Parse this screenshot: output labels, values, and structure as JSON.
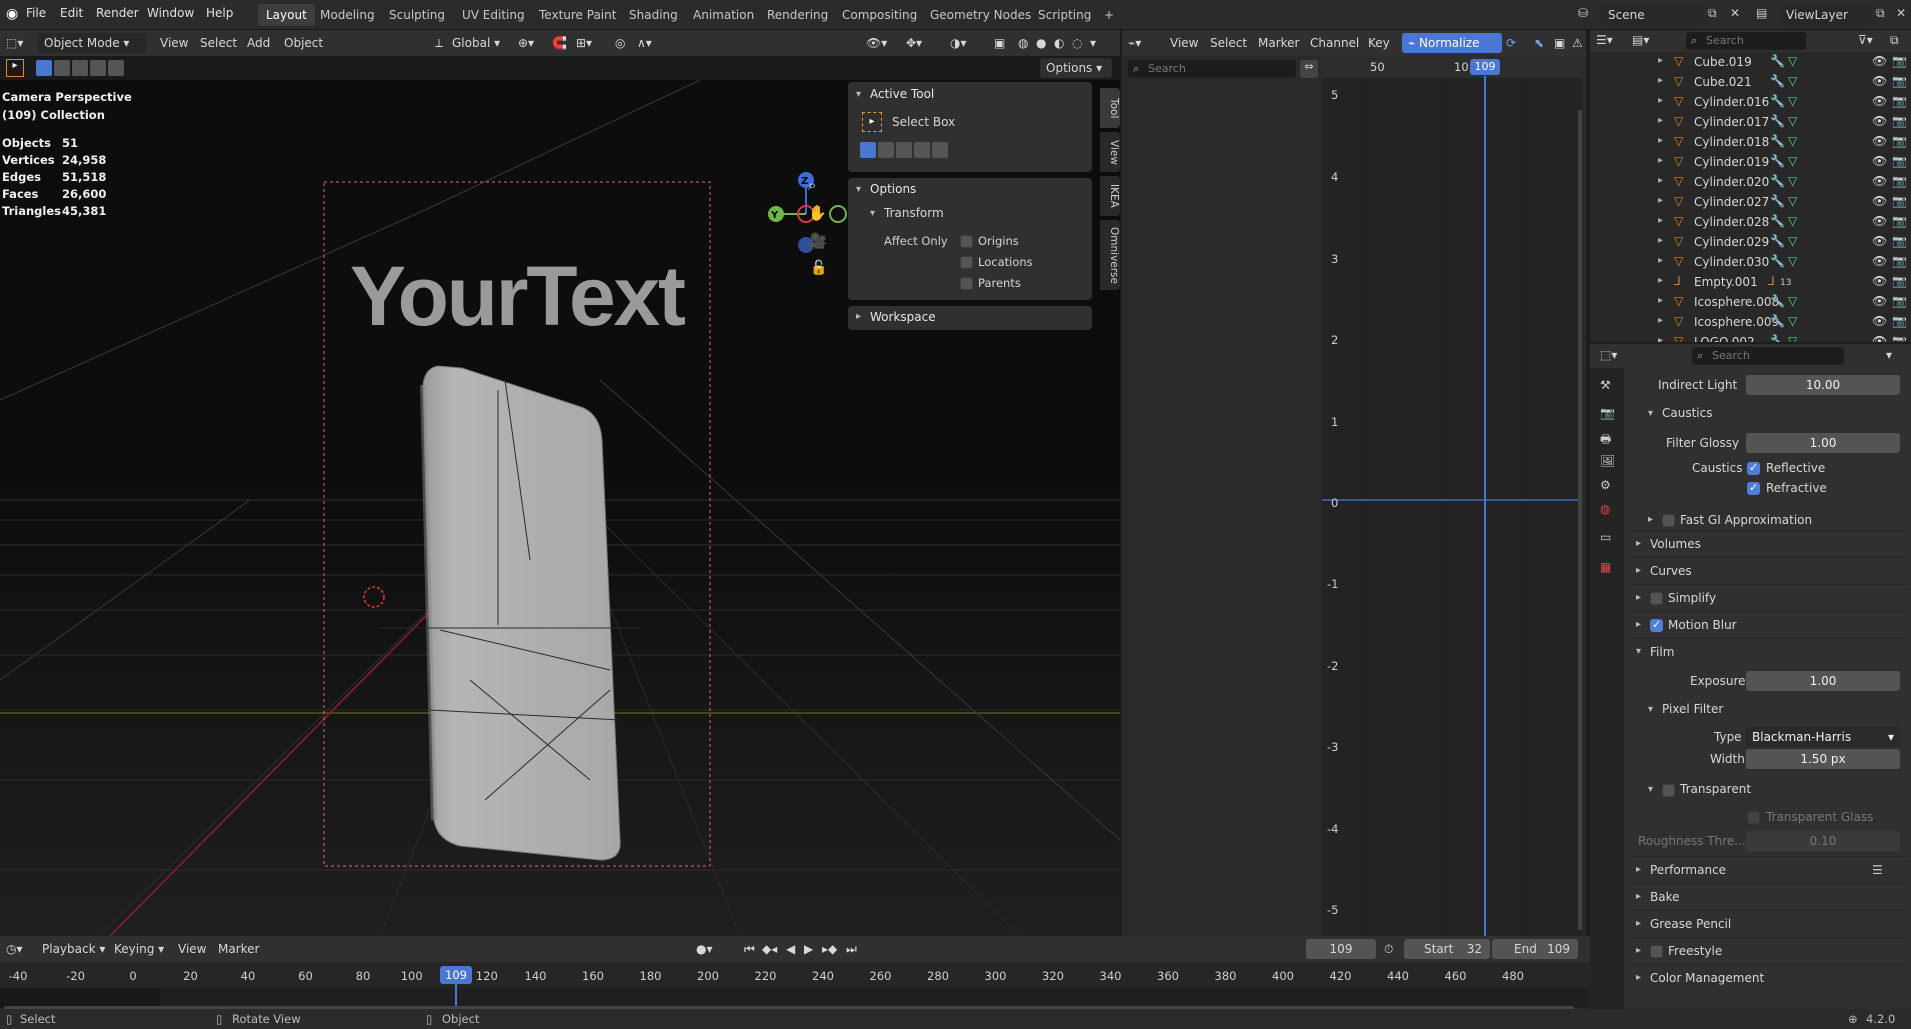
{
  "topbar": {
    "menus": [
      "File",
      "Edit",
      "Render",
      "Window",
      "Help"
    ],
    "workspaces": [
      "Layout",
      "Modeling",
      "Sculpting",
      "UV Editing",
      "Texture Paint",
      "Shading",
      "Animation",
      "Rendering",
      "Compositing",
      "Geometry Nodes",
      "Scripting"
    ],
    "active_workspace": "Layout",
    "add_tab": "+",
    "scene_label": "Scene",
    "viewlayer_label": "ViewLayer"
  },
  "viewport_header": {
    "mode": "Object Mode",
    "menus": [
      "View",
      "Select",
      "Add",
      "Object"
    ],
    "orientation": "Global",
    "options_label": "Options"
  },
  "viewport": {
    "camera_label": "Camera Perspective",
    "collection_label": "(109) Collection",
    "stats": [
      {
        "label": "Objects",
        "value": "51"
      },
      {
        "label": "Vertices",
        "value": "24,958"
      },
      {
        "label": "Edges",
        "value": "51,518"
      },
      {
        "label": "Faces",
        "value": "26,600"
      },
      {
        "label": "Triangles",
        "value": "45,381"
      }
    ],
    "text_object": "YourText",
    "gizmo": {
      "z": "Z",
      "y": "Y"
    }
  },
  "npanel": {
    "active_tool_title": "Active Tool",
    "tool_name": "Select Box",
    "options_title": "Options",
    "transform_title": "Transform",
    "affect_only_label": "Affect Only",
    "affect_options": [
      {
        "label": "Origins",
        "checked": false
      },
      {
        "label": "Locations",
        "checked": false
      },
      {
        "label": "Parents",
        "checked": false
      }
    ],
    "workspace_title": "Workspace",
    "side_tabs": [
      "Tool",
      "View",
      "IKEA",
      "Omniverse"
    ]
  },
  "graph_editor": {
    "menus": [
      "View",
      "Select",
      "Marker",
      "Channel",
      "Key"
    ],
    "normalize_label": "Normalize",
    "search_placeholder": "Search",
    "x_ticks": [
      "50",
      "10"
    ],
    "current_frame": "109",
    "y_ticks": [
      "5",
      "4",
      "3",
      "2",
      "1",
      "0",
      "-1",
      "-2",
      "-3",
      "-4",
      "-5"
    ]
  },
  "outliner": {
    "search_placeholder": "Search",
    "items": [
      {
        "name": "Cube.019",
        "type": "mesh"
      },
      {
        "name": "Cube.021",
        "type": "mesh"
      },
      {
        "name": "Cylinder.016",
        "type": "mesh"
      },
      {
        "name": "Cylinder.017",
        "type": "mesh"
      },
      {
        "name": "Cylinder.018",
        "type": "mesh"
      },
      {
        "name": "Cylinder.019",
        "type": "mesh"
      },
      {
        "name": "Cylinder.020",
        "type": "mesh"
      },
      {
        "name": "Cylinder.027",
        "type": "mesh"
      },
      {
        "name": "Cylinder.028",
        "type": "mesh"
      },
      {
        "name": "Cylinder.029",
        "type": "mesh"
      },
      {
        "name": "Cylinder.030",
        "type": "mesh"
      },
      {
        "name": "Empty.001",
        "type": "empty",
        "badge": "13"
      },
      {
        "name": "Icosphere.008",
        "type": "mesh"
      },
      {
        "name": "Icosphere.009",
        "type": "mesh"
      },
      {
        "name": "LOGO.002",
        "type": "mesh"
      }
    ]
  },
  "properties": {
    "search_placeholder": "Search",
    "indirect_light_label": "Indirect Light",
    "indirect_light_value": "10.00",
    "caustics_title": "Caustics",
    "filter_glossy_label": "Filter Glossy",
    "filter_glossy_value": "1.00",
    "caustics_label": "Caustics",
    "reflective_label": "Reflective",
    "refractive_label": "Refractive",
    "fast_gi_label": "Fast GI Approximation",
    "volumes_label": "Volumes",
    "curves_label": "Curves",
    "simplify_label": "Simplify",
    "motion_blur_label": "Motion Blur",
    "film_label": "Film",
    "exposure_label": "Exposure",
    "exposure_value": "1.00",
    "pixel_filter_label": "Pixel Filter",
    "type_label": "Type",
    "type_value": "Blackman-Harris",
    "width_label": "Width",
    "width_value": "1.50 px",
    "transparent_label": "Transparent",
    "transparent_glass_label": "Transparent Glass",
    "roughness_label": "Roughness Thre...",
    "roughness_value": "0.10",
    "performance_label": "Performance",
    "bake_label": "Bake",
    "grease_pencil_label": "Grease Pencil",
    "freestyle_label": "Freestyle",
    "color_management_label": "Color Management"
  },
  "timeline": {
    "menus": [
      "Playback",
      "Keying",
      "View",
      "Marker"
    ],
    "current_frame": "109",
    "start_label": "Start",
    "start_value": "32",
    "end_label": "End",
    "end_value": "109",
    "ticks": [
      "-40",
      "-20",
      "0",
      "20",
      "40",
      "60",
      "80",
      "100",
      "120",
      "140",
      "160",
      "180",
      "200",
      "220",
      "240",
      "260",
      "280",
      "300",
      "320",
      "340",
      "360",
      "380",
      "400",
      "420",
      "440",
      "460",
      "480"
    ],
    "playhead_label": "109"
  },
  "statusbar": {
    "select": "Select",
    "rotate": "Rotate View",
    "object": "Object",
    "version": "4.2.0"
  },
  "colors": {
    "accent": "#4a76d4",
    "mesh_orange": "#e0862a",
    "modifier_blue": "#6fa0e8",
    "data_green": "#5fd48c"
  }
}
